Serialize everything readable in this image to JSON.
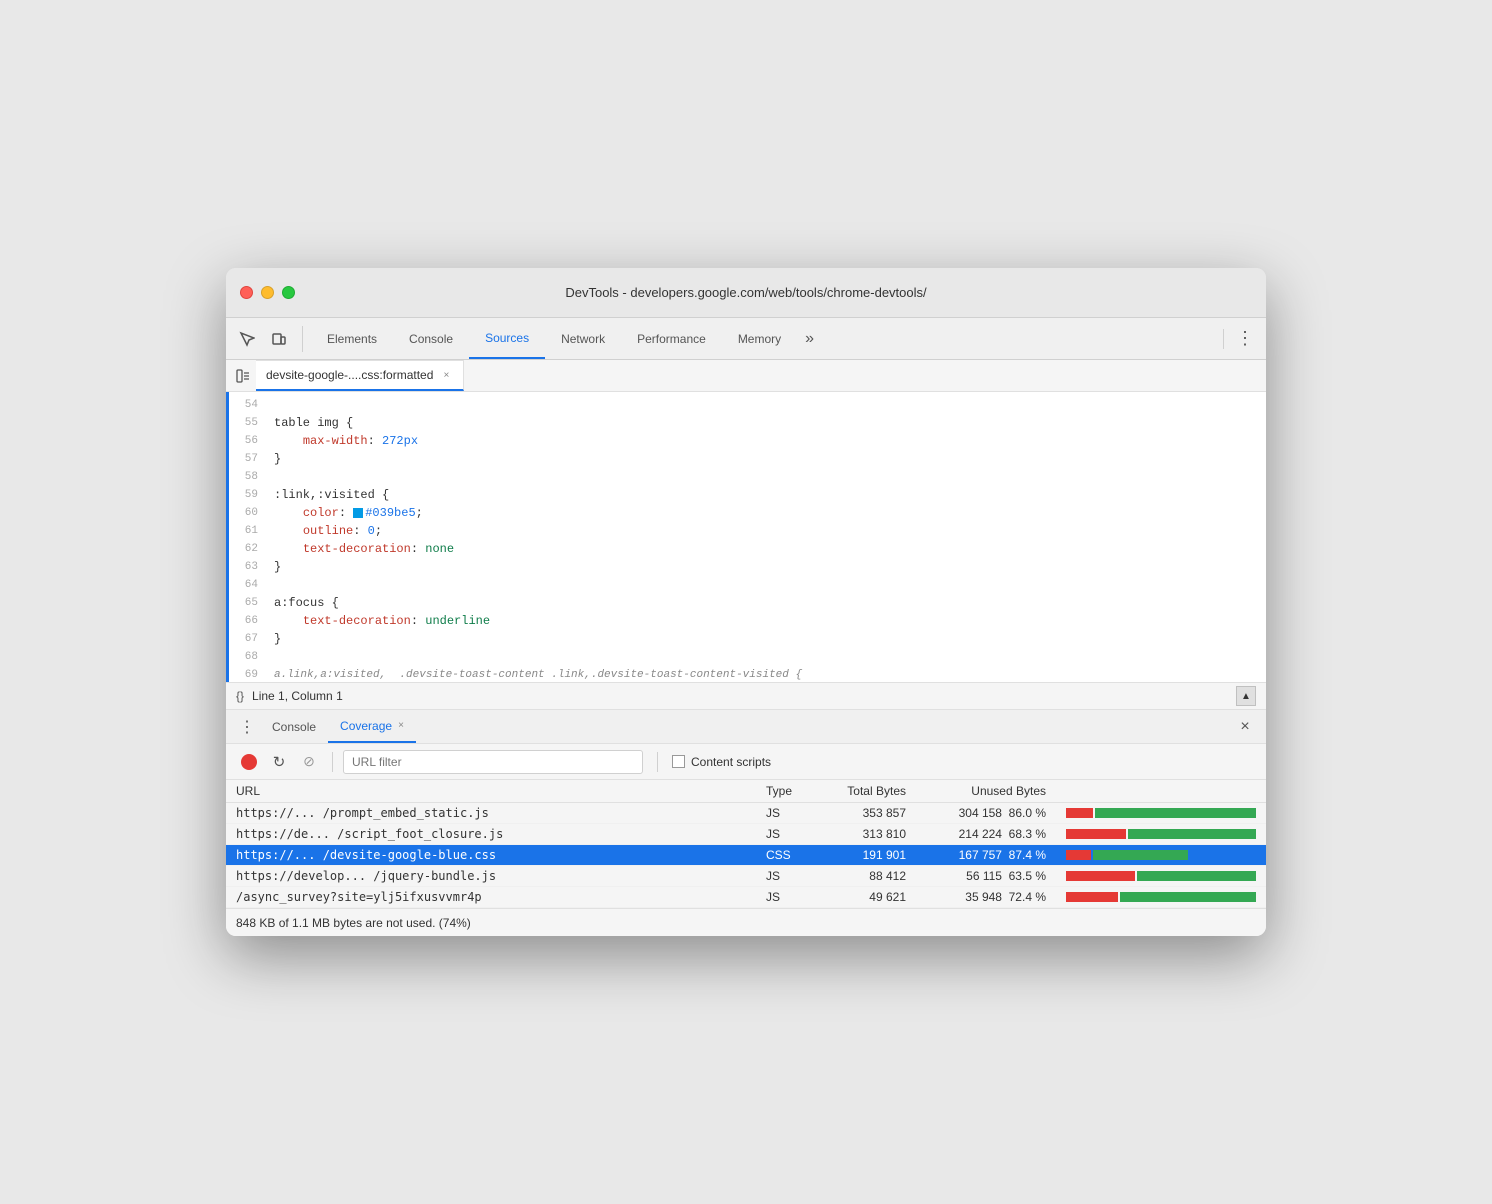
{
  "window": {
    "title": "DevTools - developers.google.com/web/tools/chrome-devtools/"
  },
  "nav": {
    "tabs": [
      {
        "id": "elements",
        "label": "Elements",
        "active": false
      },
      {
        "id": "console",
        "label": "Console",
        "active": false
      },
      {
        "id": "sources",
        "label": "Sources",
        "active": true
      },
      {
        "id": "network",
        "label": "Network",
        "active": false
      },
      {
        "id": "performance",
        "label": "Performance",
        "active": false
      },
      {
        "id": "memory",
        "label": "Memory",
        "active": false
      }
    ],
    "more_label": "»"
  },
  "file_tab": {
    "name": "devsite-google-....css:formatted",
    "close": "×"
  },
  "code": {
    "lines": [
      {
        "num": "54",
        "content": "",
        "type": "blank"
      },
      {
        "num": "55",
        "content": "table img {",
        "type": "selector"
      },
      {
        "num": "56",
        "content": "    max-width: 272px",
        "type": "prop-value",
        "prop": "max-width",
        "value": "272px",
        "value_type": "number"
      },
      {
        "num": "57",
        "content": "}",
        "type": "punc"
      },
      {
        "num": "58",
        "content": "",
        "type": "blank"
      },
      {
        "num": "59",
        "content": ":link,:visited {",
        "type": "selector"
      },
      {
        "num": "60",
        "content": "    color: #039be5;",
        "type": "prop-value",
        "prop": "color",
        "value": "#039be5",
        "value_type": "color",
        "swatch": "#039be5"
      },
      {
        "num": "61",
        "content": "    outline: 0;",
        "type": "prop-value",
        "prop": "outline",
        "value": "0",
        "value_type": "number"
      },
      {
        "num": "62",
        "content": "    text-decoration: none",
        "type": "prop-value",
        "prop": "text-decoration",
        "value": "none",
        "value_type": "string"
      },
      {
        "num": "63",
        "content": "}",
        "type": "punc"
      },
      {
        "num": "64",
        "content": "",
        "type": "blank"
      },
      {
        "num": "65",
        "content": "a:focus {",
        "type": "selector"
      },
      {
        "num": "66",
        "content": "    text-decoration: underline",
        "type": "prop-value",
        "prop": "text-decoration",
        "value": "underline",
        "value_type": "string"
      },
      {
        "num": "67",
        "content": "}",
        "type": "punc"
      },
      {
        "num": "68",
        "content": "",
        "type": "blank"
      },
      {
        "num": "69",
        "content": "a.link,a:visited,...",
        "type": "cut"
      }
    ]
  },
  "status_bar": {
    "braces": "{}",
    "position": "Line 1, Column 1"
  },
  "bottom_panel": {
    "tabs": [
      {
        "id": "console",
        "label": "Console",
        "active": false,
        "closeable": false
      },
      {
        "id": "coverage",
        "label": "Coverage",
        "active": true,
        "closeable": true
      }
    ]
  },
  "coverage": {
    "toolbar": {
      "record_title": "Start/Stop recording",
      "reload_title": "Reload",
      "clear_title": "Clear",
      "filter_placeholder": "URL filter",
      "content_scripts_label": "Content scripts"
    },
    "table": {
      "headers": [
        "URL",
        "Type",
        "Total Bytes",
        "Unused Bytes",
        ""
      ],
      "rows": [
        {
          "url": "https://... /prompt_embed_static.js",
          "type": "JS",
          "total_bytes": "353 857",
          "unused_bytes": "304 158",
          "unused_pct": "86.0 %",
          "used_ratio": 14,
          "unused_ratio": 86,
          "active": false
        },
        {
          "url": "https://de... /script_foot_closure.js",
          "type": "JS",
          "total_bytes": "313 810",
          "unused_bytes": "214 224",
          "unused_pct": "68.3 %",
          "used_ratio": 32,
          "unused_ratio": 68,
          "active": false
        },
        {
          "url": "https://... /devsite-google-blue.css",
          "type": "CSS",
          "total_bytes": "191 901",
          "unused_bytes": "167 757",
          "unused_pct": "87.4 %",
          "used_ratio": 13,
          "unused_ratio": 50,
          "active": true
        },
        {
          "url": "https://develop... /jquery-bundle.js",
          "type": "JS",
          "total_bytes": "88 412",
          "unused_bytes": "56 115",
          "unused_pct": "63.5 %",
          "used_ratio": 37,
          "unused_ratio": 63,
          "active": false
        },
        {
          "url": "/async_survey?site=ylj5ifxusvvmr4p",
          "type": "JS",
          "total_bytes": "49 621",
          "unused_bytes": "35 948",
          "unused_pct": "72.4 %",
          "used_ratio": 28,
          "unused_ratio": 72,
          "active": false
        }
      ]
    },
    "footer": "848 KB of 1.1 MB bytes are not used. (74%)"
  }
}
